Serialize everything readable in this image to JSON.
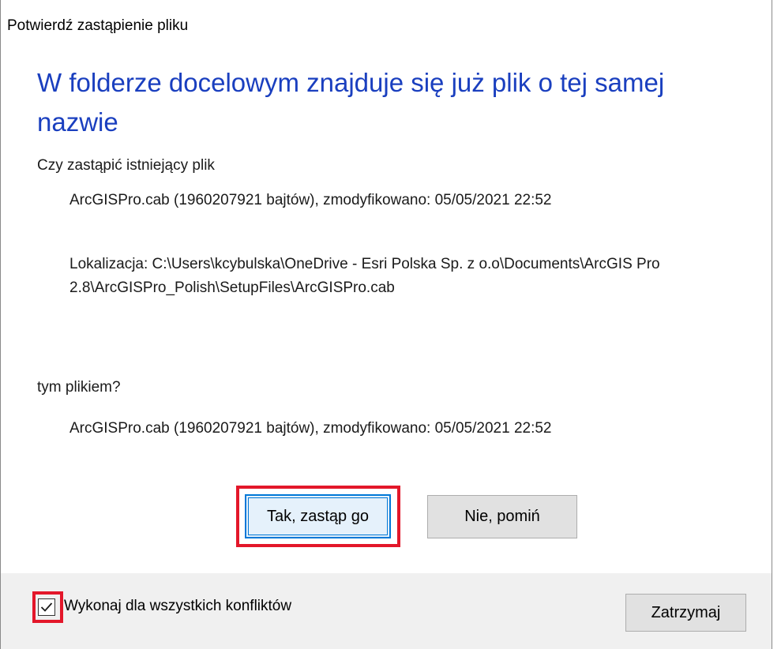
{
  "dialog": {
    "title": "Potwierdź zastąpienie pliku",
    "heading": "W folderze docelowym znajduje się już plik o tej samej nazwie",
    "question_replace": "Czy zastąpić istniejący plik",
    "existing_file": {
      "info": "ArcGISPro.cab (1960207921 bajtów), zmodyfikowano: 05/05/2021 22:52",
      "location": "Lokalizacja: C:\\Users\\kcybulska\\OneDrive - Esri Polska Sp. z o.o\\Documents\\ArcGIS Pro 2.8\\ArcGISPro_Polish\\SetupFiles\\ArcGISPro.cab"
    },
    "question_with": "tym plikiem?",
    "new_file": {
      "info": "ArcGISPro.cab (1960207921 bajtów), zmodyfikowano: 05/05/2021 22:52"
    },
    "buttons": {
      "replace": "Tak, zastąp go",
      "skip": "Nie, pomiń",
      "stop": "Zatrzymaj"
    },
    "apply_all": {
      "label": "Wykonaj dla wszystkich konfliktów",
      "checked": true
    }
  },
  "colors": {
    "heading": "#1a3fbf",
    "highlight": "#e3172a",
    "primary_border": "#0078d7",
    "footer_bg": "#f0f0f0"
  }
}
